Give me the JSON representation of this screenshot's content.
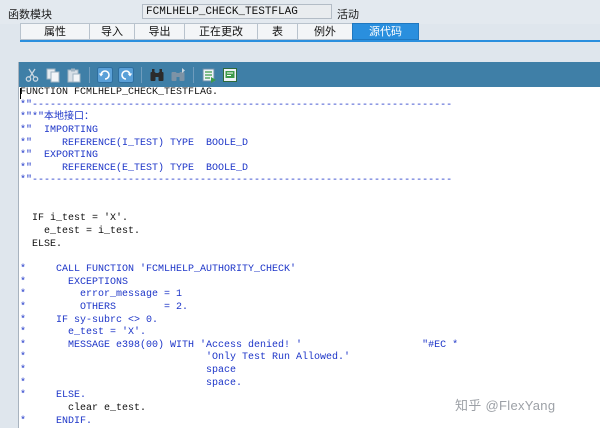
{
  "header": {
    "label": "函数模块",
    "function_name": "FCMLHELP_CHECK_TESTFLAG",
    "status": "活动"
  },
  "tabs": [
    {
      "label": "属性",
      "active": false
    },
    {
      "label": "导入",
      "active": false
    },
    {
      "label": "导出",
      "active": false
    },
    {
      "label": "正在更改",
      "active": false
    },
    {
      "label": "表",
      "active": false
    },
    {
      "label": "例外",
      "active": false
    },
    {
      "label": "源代码",
      "active": true
    }
  ],
  "toolbar": {
    "icons": [
      "cut-icon",
      "copy-icon",
      "paste-icon",
      "undo-icon",
      "redo-icon",
      "find-icon",
      "find-next-icon",
      "insert-pattern-icon",
      "pretty-printer-icon"
    ]
  },
  "code_lines": [
    {
      "text": "FUNCTION FCMLHELP_CHECK_TESTFLAG.",
      "comment": false
    },
    {
      "text": "*\"----------------------------------------------------------------------",
      "comment": true
    },
    {
      "text": "*\"*\"本地接口：",
      "comment": true
    },
    {
      "text": "*\"  IMPORTING",
      "comment": true
    },
    {
      "text": "*\"     REFERENCE(I_TEST) TYPE  BOOLE_D",
      "comment": true
    },
    {
      "text": "*\"  EXPORTING",
      "comment": true
    },
    {
      "text": "*\"     REFERENCE(E_TEST) TYPE  BOOLE_D",
      "comment": true
    },
    {
      "text": "*\"----------------------------------------------------------------------",
      "comment": true
    },
    {
      "text": "",
      "comment": false
    },
    {
      "text": "",
      "comment": false
    },
    {
      "text": "  IF i_test = 'X'.",
      "comment": false
    },
    {
      "text": "    e_test = i_test.",
      "comment": false
    },
    {
      "text": "  ELSE.",
      "comment": false
    },
    {
      "text": "",
      "comment": false
    },
    {
      "text": "*     CALL FUNCTION 'FCMLHELP_AUTHORITY_CHECK'",
      "comment": true
    },
    {
      "text": "*       EXCEPTIONS",
      "comment": true
    },
    {
      "text": "*         error_message = 1",
      "comment": true
    },
    {
      "text": "*         OTHERS        = 2.",
      "comment": true
    },
    {
      "text": "*     IF sy-subrc <> 0.",
      "comment": true
    },
    {
      "text": "*       e_test = 'X'.",
      "comment": true
    },
    {
      "text": "*       MESSAGE e398(00) WITH 'Access denied! '                    \"#EC *",
      "comment": true
    },
    {
      "text": "*                              'Only Test Run Allowed.'",
      "comment": true
    },
    {
      "text": "*                              space",
      "comment": true
    },
    {
      "text": "*                              space.",
      "comment": true
    },
    {
      "text": "*     ELSE.",
      "comment": true
    },
    {
      "text": "        clear e_test.",
      "comment": false
    },
    {
      "text": "*     ENDIF.",
      "comment": true
    }
  ],
  "watermark": "知乎 @FlexYang"
}
